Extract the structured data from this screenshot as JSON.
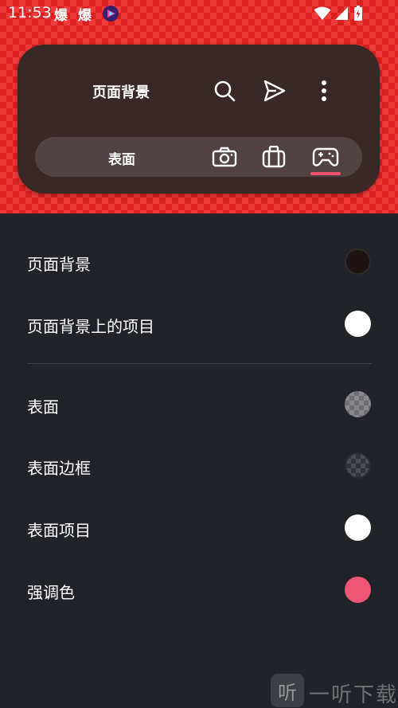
{
  "status_bar": {
    "time": "11:53",
    "notif_1": "爆",
    "notif_2": "爆"
  },
  "card": {
    "title": "页面背景",
    "tab_label": "表面"
  },
  "rows": [
    {
      "label": "页面背景",
      "swatch_color": "#1e1212"
    },
    {
      "label": "页面背景上的项目",
      "swatch_color": "#ffffff"
    },
    {
      "label": "表面",
      "swatch_color": "checker-light"
    },
    {
      "label": "表面边框",
      "swatch_color": "checker-dark"
    },
    {
      "label": "表面项目",
      "swatch_color": "#ffffff"
    },
    {
      "label": "强调色",
      "swatch_color": "#ee5673"
    }
  ],
  "watermark": {
    "logo_char": "听",
    "text": "一听下载"
  },
  "colors": {
    "page_background": "#212329",
    "card_background": "#3a2727",
    "tab_bar_background": "#524243",
    "accent": "#f0536e",
    "header_checker_red": "#d9201f"
  },
  "icons": [
    "search-icon",
    "send-icon",
    "more-vert-icon",
    "camera-icon",
    "bag-icon",
    "gamepad-icon"
  ]
}
